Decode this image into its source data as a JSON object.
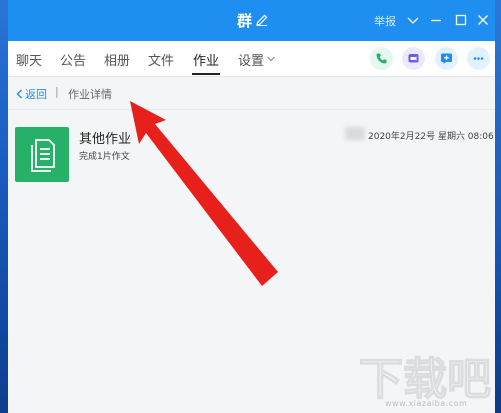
{
  "window": {
    "group_name": "群",
    "report_label": "举报"
  },
  "tabs": [
    {
      "label": "聊天"
    },
    {
      "label": "公告"
    },
    {
      "label": "相册"
    },
    {
      "label": "文件"
    },
    {
      "label": "作业",
      "active": true
    },
    {
      "label": "设置"
    }
  ],
  "breadcrumb": {
    "back_label": "返回",
    "separator": "|",
    "title": "作业详情"
  },
  "homework": {
    "title": "其他作业",
    "description": "完成1片作文",
    "date": "2020年2月22号 星期六 08:06"
  },
  "watermark": {
    "brand": "下载吧",
    "url": "www.xiazaiba.com"
  },
  "colors": {
    "titlebar": "#1e8ff0",
    "accent": "#1e8ff0",
    "doc_tile": "#27b168",
    "arrow": "#e8201c"
  },
  "icons": {
    "edit": "pencil-icon",
    "call": "phone-icon",
    "video": "video-call-icon",
    "add_app": "add-app-icon",
    "more": "more-icon",
    "document": "document-icon"
  }
}
